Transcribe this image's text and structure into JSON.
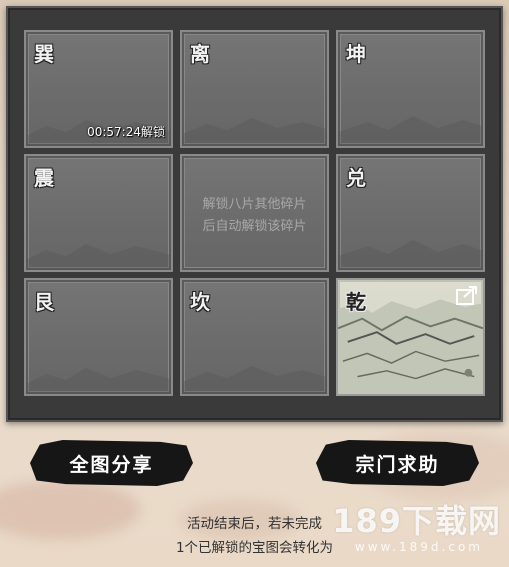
{
  "grid": {
    "cells": [
      {
        "glyph": "巽",
        "timer": "00:57:24解锁"
      },
      {
        "glyph": "离"
      },
      {
        "glyph": "坤"
      },
      {
        "glyph": "震"
      },
      {
        "hint_line1": "解锁八片其他碎片",
        "hint_line2": "后自动解锁该碎片"
      },
      {
        "glyph": "兑"
      },
      {
        "glyph": "艮"
      },
      {
        "glyph": "坎"
      },
      {
        "glyph": "乾",
        "share_icon": "share-icon"
      }
    ]
  },
  "buttons": {
    "share_full_map": "全图分享",
    "sect_help": "宗门求助"
  },
  "description": {
    "line1": "活动结束后，若未完成",
    "line2": "1个已解锁的宝图会转化为"
  },
  "watermark": {
    "text": "189下载网",
    "url": "www.189d.com"
  }
}
